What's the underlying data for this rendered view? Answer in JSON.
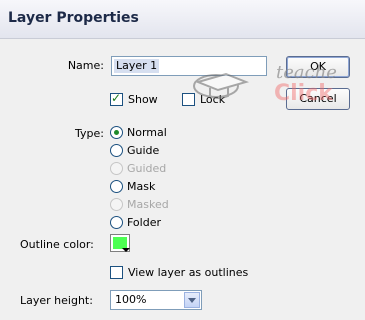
{
  "window": {
    "title": "Layer Properties"
  },
  "name_field": {
    "label": "Name:",
    "value": "Layer 1"
  },
  "buttons": {
    "ok": "OK",
    "cancel": "Cancel"
  },
  "checkboxes": {
    "show": {
      "label": "Show",
      "checked": true
    },
    "lock": {
      "label": "Lock",
      "checked": false
    },
    "outlines": {
      "label": "View layer as outlines",
      "checked": false
    }
  },
  "type": {
    "label": "Type:",
    "options": [
      {
        "label": "Normal",
        "selected": true,
        "enabled": true
      },
      {
        "label": "Guide",
        "selected": false,
        "enabled": true
      },
      {
        "label": "Guided",
        "selected": false,
        "enabled": false
      },
      {
        "label": "Mask",
        "selected": false,
        "enabled": true
      },
      {
        "label": "Masked",
        "selected": false,
        "enabled": false
      },
      {
        "label": "Folder",
        "selected": false,
        "enabled": true
      }
    ]
  },
  "outline_color": {
    "label": "Outline color:",
    "color": "#4cff52"
  },
  "layer_height": {
    "label": "Layer height:",
    "value": "100%"
  },
  "watermark": {
    "text_top": "teacher",
    "text_bottom": "Click"
  }
}
